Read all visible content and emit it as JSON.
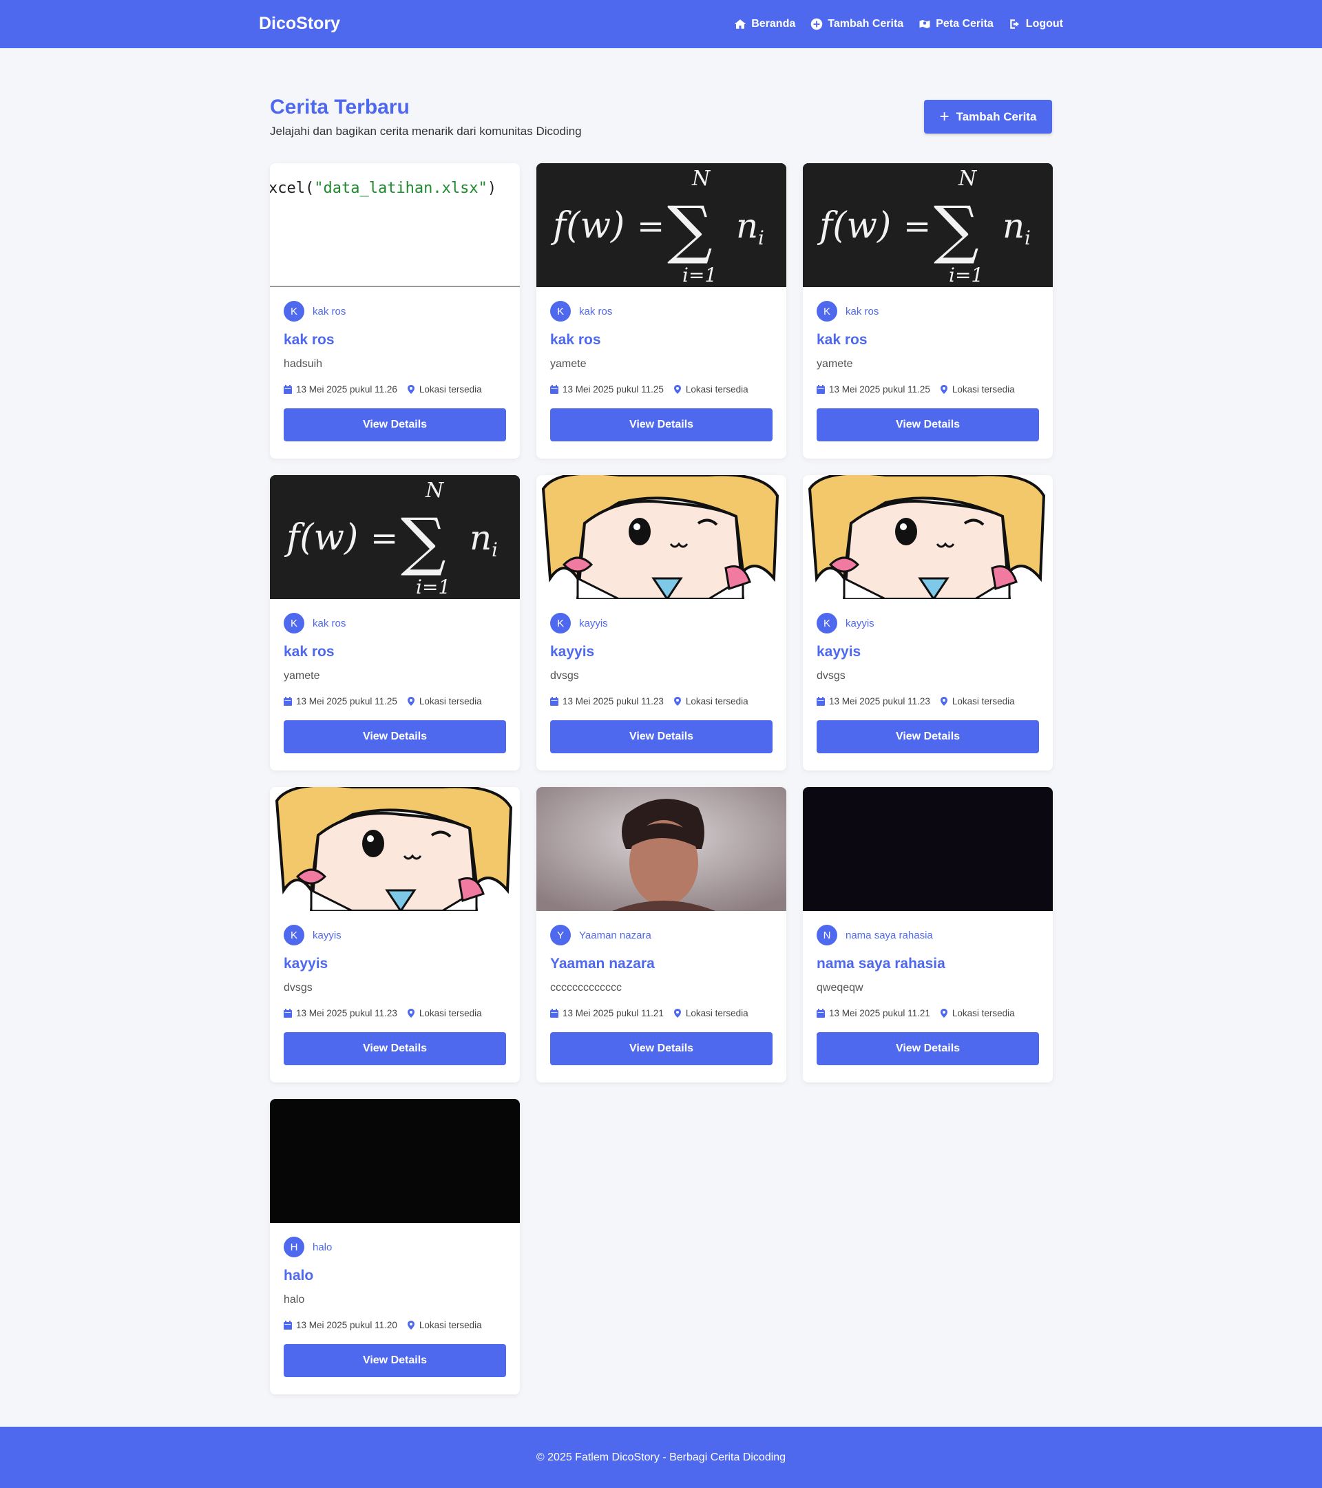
{
  "brand": "DicoStory",
  "nav": {
    "home": "Beranda",
    "add_story": "Tambah Cerita",
    "map": "Peta Cerita",
    "logout": "Logout"
  },
  "page": {
    "title": "Cerita Terbaru",
    "subtitle": "Jelajahi dan bagikan cerita menarik dari komunitas Dicoding",
    "add_button": "Tambah Cerita"
  },
  "image_texts": {
    "code_prefix": "xcel(",
    "code_string": "\"data_latihan.xlsx\"",
    "code_suffix": ")"
  },
  "stories": [
    {
      "initial": "K",
      "author": "kak ros",
      "title": "kak ros",
      "description": "hadsuih",
      "date": "13 Mei 2025 pukul 11.26",
      "location": "Lokasi tersedia",
      "button": "View Details",
      "image": "code-screenshot"
    },
    {
      "initial": "K",
      "author": "kak ros",
      "title": "kak ros",
      "description": "yamete",
      "date": "13 Mei 2025 pukul 11.25",
      "location": "Lokasi tersedia",
      "button": "View Details",
      "image": "math-formula"
    },
    {
      "initial": "K",
      "author": "kak ros",
      "title": "kak ros",
      "description": "yamete",
      "date": "13 Mei 2025 pukul 11.25",
      "location": "Lokasi tersedia",
      "button": "View Details",
      "image": "math-formula"
    },
    {
      "initial": "K",
      "author": "kak ros",
      "title": "kak ros",
      "description": "yamete",
      "date": "13 Mei 2025 pukul 11.25",
      "location": "Lokasi tersedia",
      "button": "View Details",
      "image": "math-formula"
    },
    {
      "initial": "K",
      "author": "kayyis",
      "title": "kayyis",
      "description": "dvsgs",
      "date": "13 Mei 2025 pukul 11.23",
      "location": "Lokasi tersedia",
      "button": "View Details",
      "image": "anime-character"
    },
    {
      "initial": "K",
      "author": "kayyis",
      "title": "kayyis",
      "description": "dvsgs",
      "date": "13 Mei 2025 pukul 11.23",
      "location": "Lokasi tersedia",
      "button": "View Details",
      "image": "anime-character"
    },
    {
      "initial": "K",
      "author": "kayyis",
      "title": "kayyis",
      "description": "dvsgs",
      "date": "13 Mei 2025 pukul 11.23",
      "location": "Lokasi tersedia",
      "button": "View Details",
      "image": "anime-character"
    },
    {
      "initial": "Y",
      "author": "Yaaman nazara",
      "title": "Yaaman nazara",
      "description": "ccccccccccccc",
      "date": "13 Mei 2025 pukul 11.21",
      "location": "Lokasi tersedia",
      "button": "View Details",
      "image": "selfie-photo"
    },
    {
      "initial": "N",
      "author": "nama saya rahasia",
      "title": "nama saya rahasia",
      "description": "qweqeqw",
      "date": "13 Mei 2025 pukul 11.21",
      "location": "Lokasi tersedia",
      "button": "View Details",
      "image": "dark-photo"
    },
    {
      "initial": "H",
      "author": "halo",
      "title": "halo",
      "description": "halo",
      "date": "13 Mei 2025 pukul 11.20",
      "location": "Lokasi tersedia",
      "button": "View Details",
      "image": "black-photo"
    }
  ],
  "footer": "© 2025 Fatlem DicoStory - Berbagi Cerita Dicoding",
  "colors": {
    "primary": "#4f69ee",
    "background": "#f5f6fa"
  },
  "icons": {
    "home": "home-icon",
    "add": "plus-circle-icon",
    "map": "map-icon",
    "logout": "logout-icon",
    "date": "calendar-icon",
    "location": "map-marker-icon"
  }
}
